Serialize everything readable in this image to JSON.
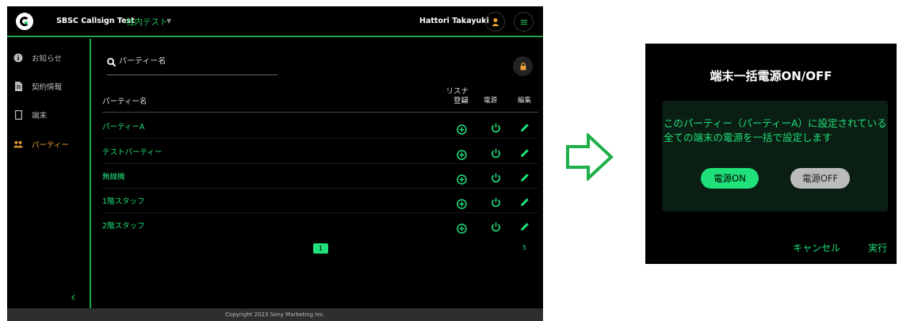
{
  "app": {
    "title": "SBSC Callsign Test",
    "environment": "社内テスト",
    "user_name": "Hattori Takayuki",
    "footer": "Copyright 2023 Sony Marketing Inc."
  },
  "sidebar": {
    "items": [
      {
        "label": "お知らせ",
        "icon": "info-icon"
      },
      {
        "label": "契約情報",
        "icon": "document-icon"
      },
      {
        "label": "端末",
        "icon": "device-icon"
      },
      {
        "label": "パーティー",
        "icon": "group-icon",
        "active": true
      }
    ]
  },
  "search": {
    "placeholder": "パーティー名"
  },
  "table": {
    "headers": {
      "name": "パーティー名",
      "listener_line1": "リスナー",
      "listener_line2": "登録",
      "power": "電源",
      "edit": "編集"
    },
    "rows": [
      {
        "name": "パーティーA"
      },
      {
        "name": "テストパーティー"
      },
      {
        "name": "無線機"
      },
      {
        "name": "1階スタッフ"
      },
      {
        "name": "2階スタッフ"
      }
    ]
  },
  "pagination": {
    "current": "1",
    "total": "5"
  },
  "dialog": {
    "title": "端末一括電源ON/OFF",
    "message": "このパーティー（パーティーA）に設定されている全ての端末の電源を一括で設定します",
    "on_label": "電源ON",
    "off_label": "電源OFF",
    "cancel_label": "キャンセル",
    "execute_label": "実行"
  },
  "colors": {
    "accent": "#1fe07a",
    "sidebar_border": "#1fa34a",
    "active_nav": "#f0a035",
    "highlight": "#e01010",
    "arrow": "#1fb04a"
  }
}
